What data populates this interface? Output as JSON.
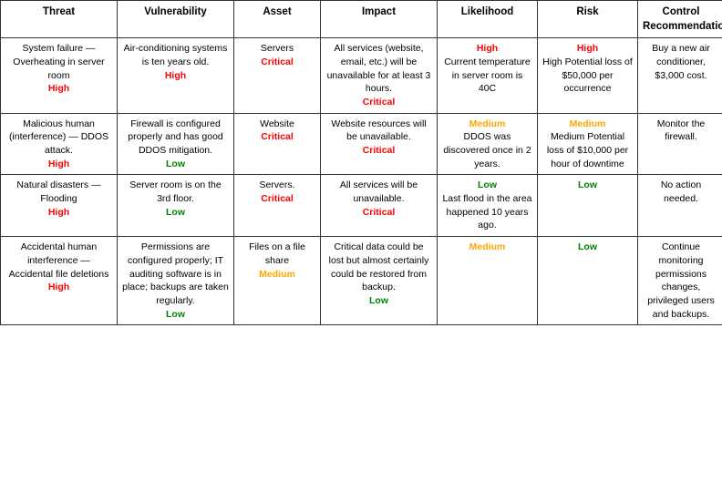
{
  "table": {
    "headers": [
      "Threat",
      "Vulnerability",
      "Asset",
      "Impact",
      "Likelihood",
      "Risk",
      "Control\nRecommendations"
    ],
    "rows": [
      {
        "threat": {
          "text": "System failure — Overheating in server room",
          "level": "High",
          "level_color": "red"
        },
        "vulnerability": {
          "text": "Air-conditioning systems is ten years old.",
          "level": "High",
          "level_color": "red"
        },
        "asset": {
          "text": "Servers",
          "level": "Critical",
          "level_color": "red"
        },
        "impact": {
          "text": "All services (website, email, etc.) will be unavailable for at least 3 hours.",
          "level": "Critical",
          "level_color": "red"
        },
        "likelihood": {
          "text": "High\nCurrent temperature in server room is 40C",
          "level": "High",
          "level_color": "red"
        },
        "risk": {
          "text": "High\nPotential loss of $50,000 per occurrence",
          "level": "High",
          "level_color": "red"
        },
        "control": {
          "text": "Buy a new air conditioner, $3,000 cost."
        }
      },
      {
        "threat": {
          "text": "Malicious human (interference) — DDOS attack.",
          "level": "High",
          "level_color": "red"
        },
        "vulnerability": {
          "text": "Firewall is configured properly and has good DDOS mitigation.",
          "level": "Low",
          "level_color": "green"
        },
        "asset": {
          "text": "Website",
          "level": "Critical",
          "level_color": "red"
        },
        "impact": {
          "text": "Website resources will be unavailable.",
          "level": "Critical",
          "level_color": "red"
        },
        "likelihood": {
          "text": "Medium\nDDOS was discovered once in 2 years.",
          "level": "Medium",
          "level_color": "orange"
        },
        "risk": {
          "text": "Medium\nPotential loss of $10,000 per hour of downtime",
          "level": "Medium",
          "level_color": "orange"
        },
        "control": {
          "text": "Monitor the firewall."
        }
      },
      {
        "threat": {
          "text": "Natural disasters — Flooding",
          "level": "High",
          "level_color": "red"
        },
        "vulnerability": {
          "text": "Server room is on the 3rd floor.",
          "level": "Low",
          "level_color": "green"
        },
        "asset": {
          "text": "Servers.",
          "level": "Critical",
          "level_color": "red"
        },
        "impact": {
          "text": "All services will be unavailable.",
          "level": "Critical",
          "level_color": "red"
        },
        "likelihood": {
          "text": "Low\nLast flood in the area happened 10 years ago.",
          "level": "Low",
          "level_color": "green"
        },
        "risk": {
          "text": "",
          "level": "Low",
          "level_color": "green"
        },
        "control": {
          "text": "No action needed."
        }
      },
      {
        "threat": {
          "text": "Accidental human interference — Accidental file deletions",
          "level": "High",
          "level_color": "red"
        },
        "vulnerability": {
          "text": "Permissions are configured properly; IT auditing software is in place; backups are taken regularly.",
          "level": "Low",
          "level_color": "green"
        },
        "asset": {
          "text": "Files on a file share",
          "level": "Medium",
          "level_color": "orange"
        },
        "impact": {
          "text": "Critical data could be lost but almost certainly could be restored from backup.",
          "level": "Low",
          "level_color": "green"
        },
        "likelihood": {
          "text": "",
          "level": "Medium",
          "level_color": "orange"
        },
        "risk": {
          "text": "",
          "level": "Low",
          "level_color": "green"
        },
        "control": {
          "text": "Continue monitoring permissions changes, privileged users and backups."
        }
      }
    ]
  }
}
